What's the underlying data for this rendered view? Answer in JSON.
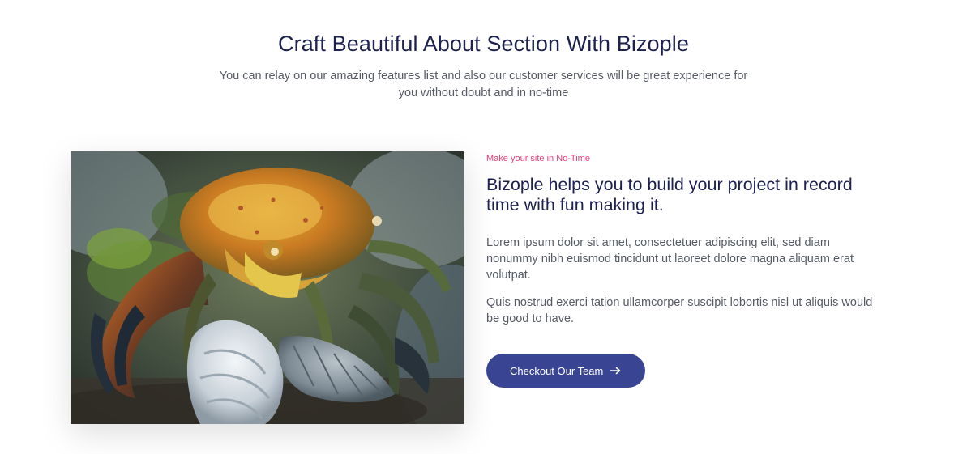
{
  "header": {
    "title": "Craft Beautiful About Section With Bizople",
    "subtitle": "You can relay on our amazing features list and also our customer services will be great experience for you without doubt and in no-time"
  },
  "media": {
    "image_subject": "crab-with-shells-photo"
  },
  "content": {
    "eyebrow": "Make your site in No-Time",
    "title": "Bizople helps you to build your project in record time with fun making it.",
    "paragraph_1": "Lorem ipsum dolor sit amet, consectetuer adipiscing elit, sed diam nonummy nibh euismod tincidunt ut laoreet dolore magna aliquam erat volutpat.",
    "paragraph_2": "Quis nostrud exerci tation ullamcorper suscipit lobortis nisl ut aliquis would be good to have.",
    "cta_label": "Checkout Our Team",
    "cta_icon": "arrow-right-icon"
  },
  "colors": {
    "title": "#1c2150",
    "body_text": "#555a64",
    "eyebrow": "#e83e74",
    "button_bg": "#394592",
    "button_text": "#ffffff"
  }
}
